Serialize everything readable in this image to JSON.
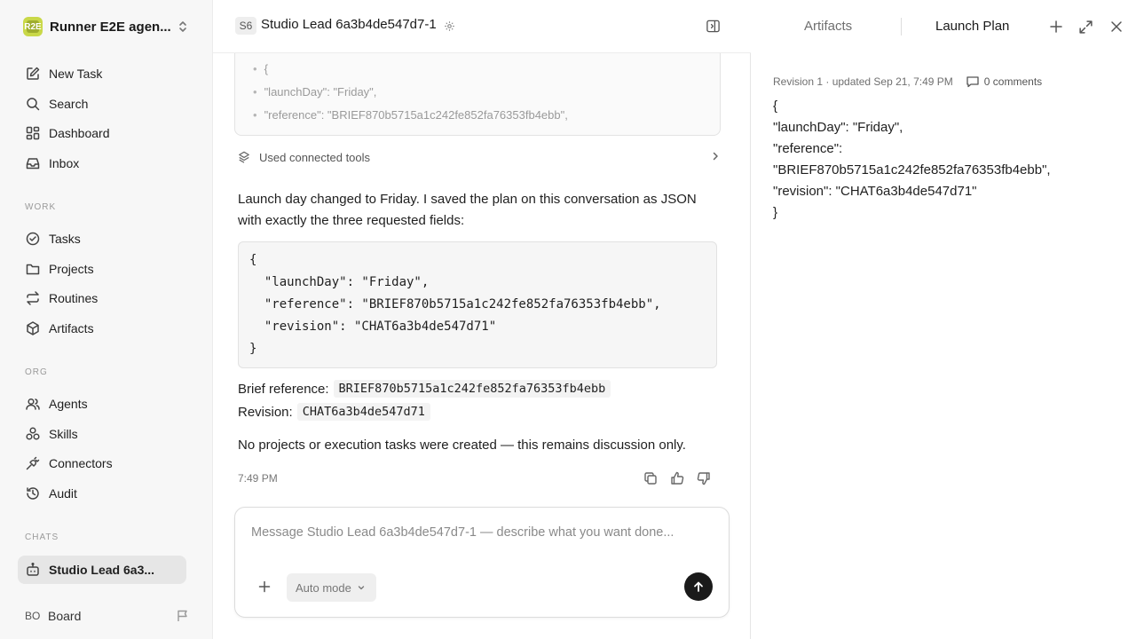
{
  "sidebar": {
    "workspace_name": "Runner E2E agen...",
    "workspace_logo_letters": "R2E",
    "nav": {
      "new_task": "New Task",
      "search": "Search",
      "dashboard": "Dashboard",
      "inbox": "Inbox"
    },
    "work_label": "WORK",
    "work": {
      "tasks": "Tasks",
      "projects": "Projects",
      "routines": "Routines",
      "artifacts": "Artifacts"
    },
    "org_label": "ORG",
    "org": {
      "agents": "Agents",
      "skills": "Skills",
      "connectors": "Connectors",
      "audit": "Audit"
    },
    "chats_label": "CHATS",
    "chats": [
      {
        "label": "Studio Lead 6a3..."
      }
    ],
    "footer": {
      "avatar": "BO",
      "name": "Board"
    }
  },
  "chat": {
    "agent_badge": "S6",
    "title": "Studio Lead 6a3b4de547d7-1",
    "tool_output_lines": [
      "{",
      "\"launchDay\": \"Friday\",",
      "\"reference\": \"BRIEF870b5715a1c242fe852fa76353fb4ebb\","
    ],
    "tools_label": "Used connected tools",
    "message": {
      "intro": "Launch day changed to Friday. I saved the plan on this conversation as JSON with exactly the three requested fields:",
      "code_lines": [
        "{",
        "  \"launchDay\": \"Friday\",",
        "  \"reference\": \"BRIEF870b5715a1c242fe852fa76353fb4ebb\",",
        "  \"revision\": \"CHAT6a3b4de547d71\"",
        "}"
      ],
      "brief_label": "Brief reference:",
      "brief_value": "BRIEF870b5715a1c242fe852fa76353fb4ebb",
      "revision_label": "Revision:",
      "revision_value": "CHAT6a3b4de547d71",
      "closing": "No projects or execution tasks were created — this remains discussion only.",
      "time": "7:49 PM"
    },
    "composer": {
      "placeholder": "Message Studio Lead 6a3b4de547d7-1 — describe what you want done...",
      "mode": "Auto mode"
    }
  },
  "artifact_panel": {
    "tabs": {
      "artifacts": "Artifacts",
      "launch_plan": "Launch Plan"
    },
    "meta": "Revision 1 · updated Sep 21, 7:49 PM",
    "comments": "0 comments",
    "content_lines": [
      "{",
      "\"launchDay\": \"Friday\",",
      "\"reference\":",
      "\"BRIEF870b5715a1c242fe852fa76353fb4ebb\",",
      "\"revision\": \"CHAT6a3b4de547d71\"",
      "}"
    ]
  }
}
